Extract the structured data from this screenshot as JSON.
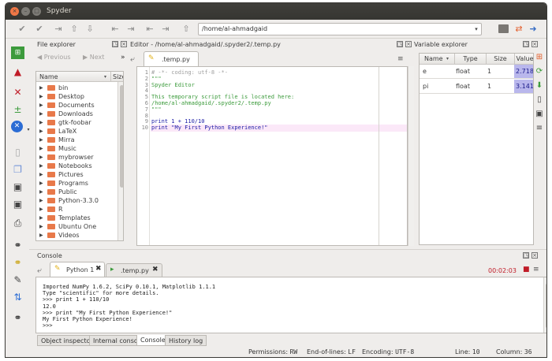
{
  "window": {
    "title": "Spyder",
    "close_glyph": "×",
    "minimize_glyph": "–",
    "maximize_glyph": "□"
  },
  "toolbar": {
    "path_value": "/home/al-ahmadgaid"
  },
  "file_explorer": {
    "title": "File explorer",
    "prev_label": "Previous",
    "next_label": "Next",
    "col_name": "Name",
    "col_size": "Size",
    "items": [
      "bin",
      "Desktop",
      "Documents",
      "Downloads",
      "gtk-foobar",
      "LaTeX",
      "Mirra",
      "Music",
      "mybrowser",
      "Notebooks",
      "Pictures",
      "Programs",
      "Public",
      "Python-3.3.0",
      "R",
      "Templates",
      "Ubuntu One",
      "Videos"
    ]
  },
  "editor": {
    "title": "Editor - /home/al-ahmadgaid/.spyder2/.temp.py",
    "tab_label": ".temp.py",
    "lines": [
      {
        "n": "1",
        "text": "# -*- coding: utf-8 -*-",
        "color": "#a0a0a0"
      },
      {
        "n": "2",
        "text": "\"\"\"",
        "color": "#3c9b3c"
      },
      {
        "n": "3",
        "text": "Spyder Editor",
        "color": "#3c9b3c"
      },
      {
        "n": "4",
        "text": "",
        "color": "#3c9b3c"
      },
      {
        "n": "5",
        "text": "This temporary script file is located here:",
        "color": "#3c9b3c"
      },
      {
        "n": "6",
        "text": "/home/al-ahmadgaid/.spyder2/.temp.py",
        "color": "#3c9b3c"
      },
      {
        "n": "7",
        "text": "\"\"\"",
        "color": "#3c9b3c"
      },
      {
        "n": "8",
        "text": "",
        "color": "#222222"
      },
      {
        "n": "9",
        "text": "print 1 + 110/10",
        "color": "#1a1aa6"
      },
      {
        "n": "10",
        "text": "print \"My First Python Experience!\"",
        "color": "#1a1aa6"
      }
    ]
  },
  "variable_explorer": {
    "title": "Variable explorer",
    "columns": [
      "Name",
      "Type",
      "Size",
      "Value"
    ],
    "rows": [
      {
        "name": "e",
        "type": "float",
        "size": "1",
        "value": "2.718…"
      },
      {
        "name": "pi",
        "type": "float",
        "size": "1",
        "value": "3.141…"
      }
    ]
  },
  "console": {
    "title": "Console",
    "tab1": "Python 1",
    "tab2": ".temp.py",
    "timer": "00:02:03",
    "lines": [
      "Imported NumPy 1.6.2, SciPy 0.10.1, Matplotlib 1.1.1",
      "Type \"scientific\" for more details.",
      ">>> print 1 + 110/10",
      "12.0",
      ">>> print \"My First Python Experience!\"",
      "My First Python Experience!",
      ">>>"
    ]
  },
  "bottom_tabs": [
    "Object inspector",
    "Internal console",
    "Console",
    "History log"
  ],
  "status": {
    "permissions_label": "Permissions:",
    "permissions_value": "RW",
    "eol_label": "End-of-lines:",
    "eol_value": "LF",
    "encoding_label": "Encoding:",
    "encoding_value": "UTF-8",
    "line_label": "Line:",
    "line_value": "10",
    "column_label": "Column:",
    "column_value": "36"
  },
  "colors": {
    "accent_value_cell": "#b9b7ec",
    "folder": "#e8794a",
    "titlebar": "#3c3b37",
    "close_button": "#f07746"
  }
}
